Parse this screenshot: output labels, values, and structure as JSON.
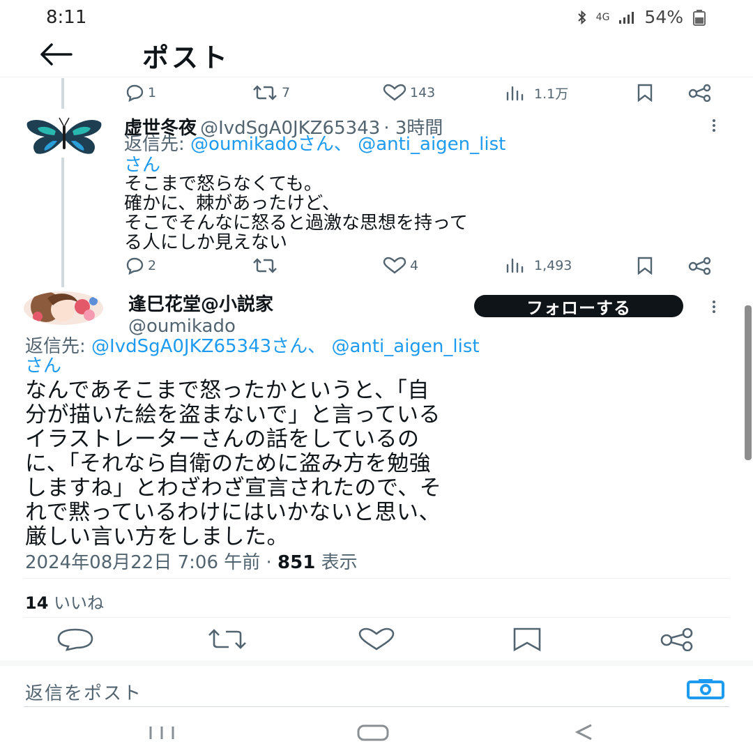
{
  "status_bar": {
    "time": "8:11",
    "network": "4G",
    "battery": "54%"
  },
  "header": {
    "title": "ポスト"
  },
  "prev_tweet_actions": {
    "replies": "1",
    "reposts": "7",
    "likes": "143",
    "views": "1.1万"
  },
  "reply1": {
    "name": "虚世冬夜",
    "handle": "@IvdSgA0JKZ65343",
    "time": "· 3時間",
    "reply_to_prefix": "返信先: ",
    "reply_to_link1": "@oumikadoさん、",
    "reply_to_link2": "@anti_aigen_list",
    "reply_to_suffix": "さん",
    "lines": [
      "そこまで怒らなくても。",
      "確かに、棘があったけど、",
      "そこでそんなに怒ると過激な思想を持って",
      "る人にしか見えない"
    ],
    "actions": {
      "replies": "2",
      "reposts": "",
      "likes": "4",
      "views": "1,493"
    }
  },
  "main_tweet": {
    "name": "逢巳花堂@小説家",
    "handle": "@oumikado",
    "follow_label": "フォローする",
    "reply_to_prefix": "返信先: ",
    "reply_to_link1": "@IvdSgA0JKZ65343さん、",
    "reply_to_link2": "@anti_aigen_list",
    "reply_to_suffix": "さん",
    "body_lines": [
      "なんであそこまで怒ったかというと、「自",
      "分が描いた絵を盗まないで」と言っている",
      "イラストレーターさんの話をしているの",
      "に、「それなら自衛のために盗み方を勉強",
      "しますね」とわざわざ宣言されたので、そ",
      "れで黙っているわけにはいかないと思い、",
      "厳しい言い方をしました。"
    ],
    "timestamp": "2024年08月22日 7:06 午前 · ",
    "views_count": "851",
    "views_label": " 表示",
    "likes_count": "14",
    "likes_label": " いいね"
  },
  "composer": {
    "placeholder": "返信をポスト"
  },
  "icons": {
    "reply": "reply-icon",
    "repost": "repost-icon",
    "like": "heart-icon",
    "views": "views-icon",
    "bookmark": "bookmark-icon",
    "share": "share-icon",
    "camera": "camera-icon"
  },
  "colors": {
    "accent": "#1d9bf0",
    "text": "#0f1419",
    "muted": "#536471"
  }
}
